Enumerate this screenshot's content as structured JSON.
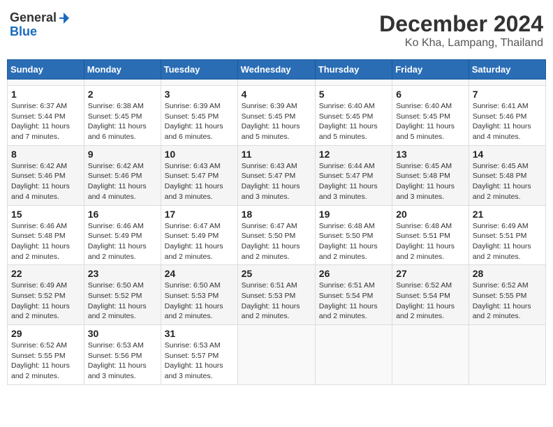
{
  "header": {
    "logo_general": "General",
    "logo_blue": "Blue",
    "title": "December 2024",
    "subtitle": "Ko Kha, Lampang, Thailand"
  },
  "calendar": {
    "days_of_week": [
      "Sunday",
      "Monday",
      "Tuesday",
      "Wednesday",
      "Thursday",
      "Friday",
      "Saturday"
    ],
    "weeks": [
      [
        {
          "day": "",
          "info": ""
        },
        {
          "day": "",
          "info": ""
        },
        {
          "day": "",
          "info": ""
        },
        {
          "day": "",
          "info": ""
        },
        {
          "day": "",
          "info": ""
        },
        {
          "day": "",
          "info": ""
        },
        {
          "day": "",
          "info": ""
        }
      ],
      [
        {
          "day": "1",
          "sunrise": "6:37 AM",
          "sunset": "5:44 PM",
          "daylight": "11 hours and 7 minutes."
        },
        {
          "day": "2",
          "sunrise": "6:38 AM",
          "sunset": "5:45 PM",
          "daylight": "11 hours and 6 minutes."
        },
        {
          "day": "3",
          "sunrise": "6:39 AM",
          "sunset": "5:45 PM",
          "daylight": "11 hours and 6 minutes."
        },
        {
          "day": "4",
          "sunrise": "6:39 AM",
          "sunset": "5:45 PM",
          "daylight": "11 hours and 5 minutes."
        },
        {
          "day": "5",
          "sunrise": "6:40 AM",
          "sunset": "5:45 PM",
          "daylight": "11 hours and 5 minutes."
        },
        {
          "day": "6",
          "sunrise": "6:40 AM",
          "sunset": "5:45 PM",
          "daylight": "11 hours and 5 minutes."
        },
        {
          "day": "7",
          "sunrise": "6:41 AM",
          "sunset": "5:46 PM",
          "daylight": "11 hours and 4 minutes."
        }
      ],
      [
        {
          "day": "8",
          "sunrise": "6:42 AM",
          "sunset": "5:46 PM",
          "daylight": "11 hours and 4 minutes."
        },
        {
          "day": "9",
          "sunrise": "6:42 AM",
          "sunset": "5:46 PM",
          "daylight": "11 hours and 4 minutes."
        },
        {
          "day": "10",
          "sunrise": "6:43 AM",
          "sunset": "5:47 PM",
          "daylight": "11 hours and 3 minutes."
        },
        {
          "day": "11",
          "sunrise": "6:43 AM",
          "sunset": "5:47 PM",
          "daylight": "11 hours and 3 minutes."
        },
        {
          "day": "12",
          "sunrise": "6:44 AM",
          "sunset": "5:47 PM",
          "daylight": "11 hours and 3 minutes."
        },
        {
          "day": "13",
          "sunrise": "6:45 AM",
          "sunset": "5:48 PM",
          "daylight": "11 hours and 3 minutes."
        },
        {
          "day": "14",
          "sunrise": "6:45 AM",
          "sunset": "5:48 PM",
          "daylight": "11 hours and 2 minutes."
        }
      ],
      [
        {
          "day": "15",
          "sunrise": "6:46 AM",
          "sunset": "5:48 PM",
          "daylight": "11 hours and 2 minutes."
        },
        {
          "day": "16",
          "sunrise": "6:46 AM",
          "sunset": "5:49 PM",
          "daylight": "11 hours and 2 minutes."
        },
        {
          "day": "17",
          "sunrise": "6:47 AM",
          "sunset": "5:49 PM",
          "daylight": "11 hours and 2 minutes."
        },
        {
          "day": "18",
          "sunrise": "6:47 AM",
          "sunset": "5:50 PM",
          "daylight": "11 hours and 2 minutes."
        },
        {
          "day": "19",
          "sunrise": "6:48 AM",
          "sunset": "5:50 PM",
          "daylight": "11 hours and 2 minutes."
        },
        {
          "day": "20",
          "sunrise": "6:48 AM",
          "sunset": "5:51 PM",
          "daylight": "11 hours and 2 minutes."
        },
        {
          "day": "21",
          "sunrise": "6:49 AM",
          "sunset": "5:51 PM",
          "daylight": "11 hours and 2 minutes."
        }
      ],
      [
        {
          "day": "22",
          "sunrise": "6:49 AM",
          "sunset": "5:52 PM",
          "daylight": "11 hours and 2 minutes."
        },
        {
          "day": "23",
          "sunrise": "6:50 AM",
          "sunset": "5:52 PM",
          "daylight": "11 hours and 2 minutes."
        },
        {
          "day": "24",
          "sunrise": "6:50 AM",
          "sunset": "5:53 PM",
          "daylight": "11 hours and 2 minutes."
        },
        {
          "day": "25",
          "sunrise": "6:51 AM",
          "sunset": "5:53 PM",
          "daylight": "11 hours and 2 minutes."
        },
        {
          "day": "26",
          "sunrise": "6:51 AM",
          "sunset": "5:54 PM",
          "daylight": "11 hours and 2 minutes."
        },
        {
          "day": "27",
          "sunrise": "6:52 AM",
          "sunset": "5:54 PM",
          "daylight": "11 hours and 2 minutes."
        },
        {
          "day": "28",
          "sunrise": "6:52 AM",
          "sunset": "5:55 PM",
          "daylight": "11 hours and 2 minutes."
        }
      ],
      [
        {
          "day": "29",
          "sunrise": "6:52 AM",
          "sunset": "5:55 PM",
          "daylight": "11 hours and 2 minutes."
        },
        {
          "day": "30",
          "sunrise": "6:53 AM",
          "sunset": "5:56 PM",
          "daylight": "11 hours and 3 minutes."
        },
        {
          "day": "31",
          "sunrise": "6:53 AM",
          "sunset": "5:57 PM",
          "daylight": "11 hours and 3 minutes."
        },
        {
          "day": "",
          "info": ""
        },
        {
          "day": "",
          "info": ""
        },
        {
          "day": "",
          "info": ""
        },
        {
          "day": "",
          "info": ""
        }
      ]
    ]
  }
}
